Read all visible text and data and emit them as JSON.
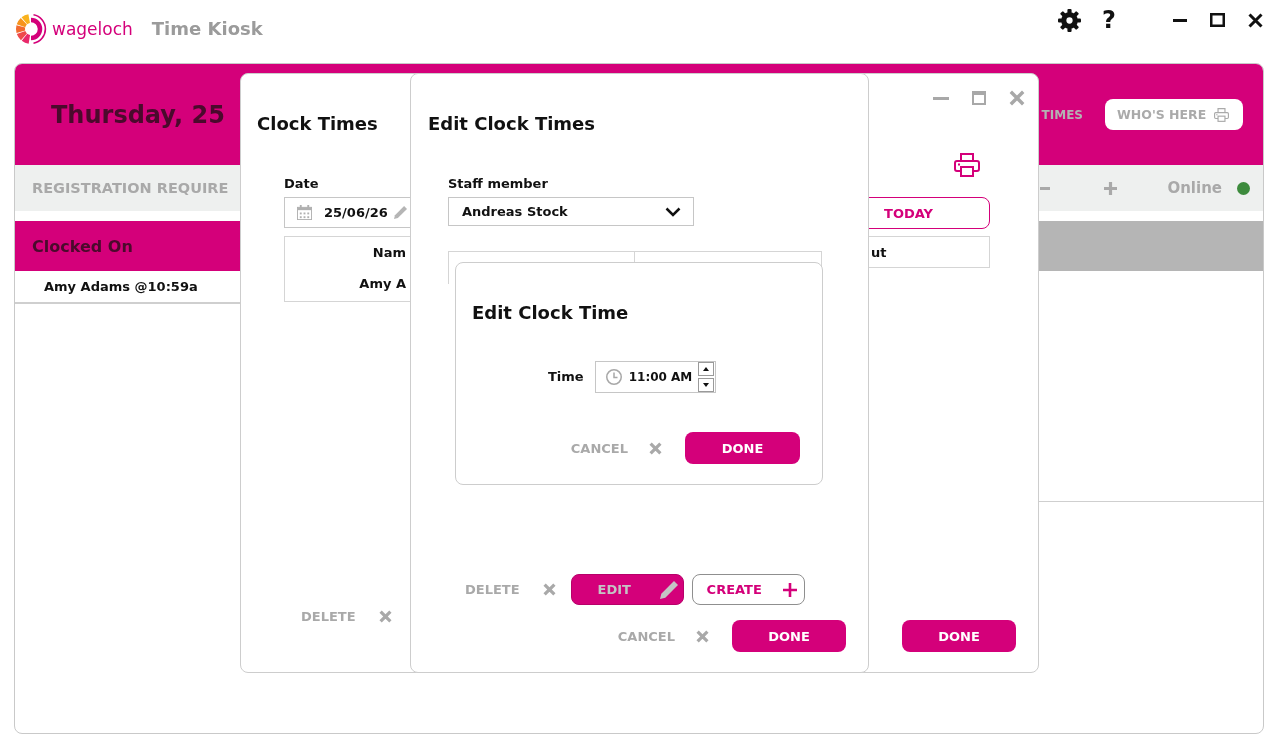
{
  "app_bar": {
    "brand": "wageloch",
    "title": "Time Kiosk",
    "help": "?"
  },
  "kiosk": {
    "date_heading": "Thursday, 25",
    "header_link": "TIMES",
    "whos_here_button": "WHO'S HERE",
    "banner": "REGISTRATION REQUIRE",
    "connection": "Online",
    "clocked_on": {
      "title": "Clocked On",
      "entries": [
        "Amy Adams @10:59a"
      ]
    }
  },
  "clock_times_dialog": {
    "title": "Clock Times",
    "date_label": "Date",
    "date_value": "25/06/26",
    "today_button": "TODAY",
    "table": {
      "columns": [
        "Nam",
        "ut"
      ],
      "rows": [
        [
          "Amy A"
        ]
      ]
    },
    "delete_button": "DELETE",
    "done_button": "DONE"
  },
  "edit_clock_times_dialog": {
    "title": "Edit Clock Times",
    "staff_label": "Staff member",
    "staff_value": "Andreas Stock",
    "actions": [
      {
        "kind": "text",
        "label": "DELETE",
        "disabled": false
      },
      {
        "kind": "filled",
        "label": "EDIT",
        "disabled": true
      },
      {
        "kind": "outline",
        "label": "CREATE",
        "disabled": false
      }
    ],
    "cancel_button": "CANCEL",
    "done_button": "DONE"
  },
  "edit_clock_time_dialog": {
    "title": "Edit Clock Time",
    "time_label": "Time",
    "time_value": "11:00 AM",
    "cancel_button": "CANCEL",
    "done_button": "DONE"
  }
}
